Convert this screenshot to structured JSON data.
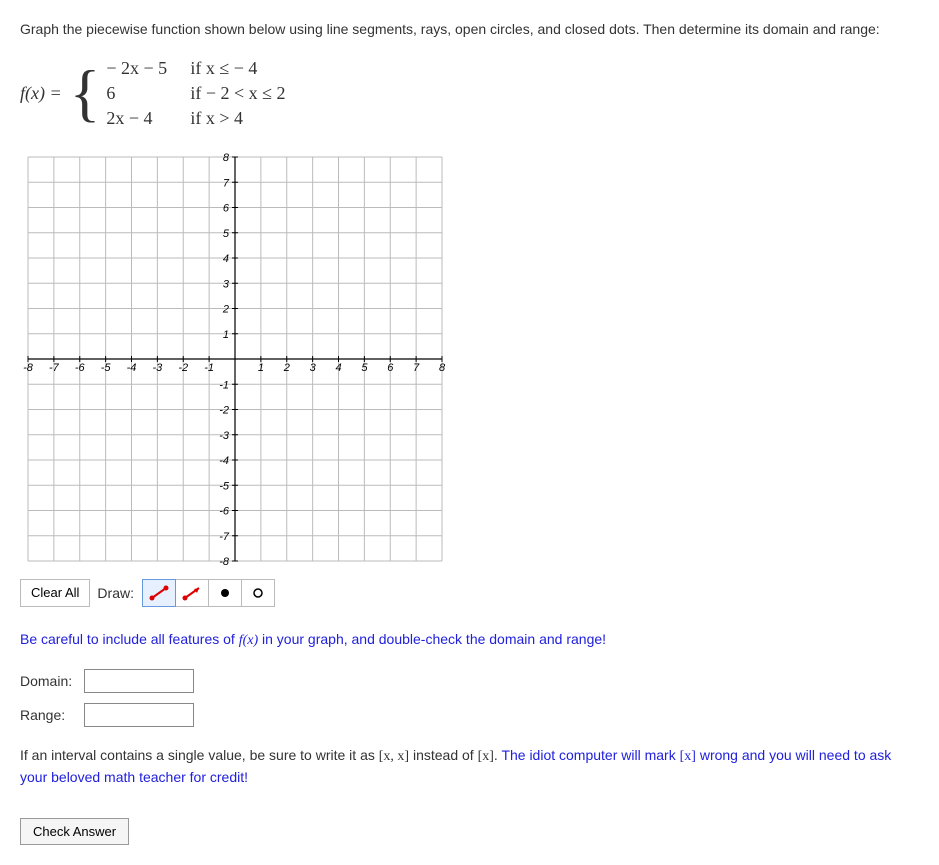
{
  "instructions": "Graph the piecewise function shown below using line segments, rays, open circles, and closed dots. Then determine its domain and range:",
  "function": {
    "lhs": "f(x) =",
    "pieces": [
      {
        "expr": "− 2x − 5",
        "cond": "if  x ≤ − 4"
      },
      {
        "expr": "6",
        "cond": "if  − 2 < x ≤ 2"
      },
      {
        "expr": "2x − 4",
        "cond": "if  x > 4"
      }
    ]
  },
  "chart_data": {
    "type": "grid",
    "xlim": [
      -8,
      8
    ],
    "ylim": [
      -8,
      8
    ],
    "xticks": [
      -8,
      -7,
      -6,
      -5,
      -4,
      -3,
      -2,
      -1,
      1,
      2,
      3,
      4,
      5,
      6,
      7,
      8
    ],
    "yticks": [
      -8,
      -7,
      -6,
      -5,
      -4,
      -3,
      -2,
      -1,
      1,
      2,
      3,
      4,
      5,
      6,
      7,
      8
    ]
  },
  "toolbar": {
    "clear_label": "Clear All",
    "draw_label": "Draw:"
  },
  "hint": {
    "prefix": "Be careful to include all features of ",
    "fx": "f(x)",
    "suffix": " in your graph, and double-check the domain and range!"
  },
  "fields": {
    "domain_label": "Domain:",
    "range_label": "Range:"
  },
  "note": {
    "p1a": "If an interval contains a single value, be sure to write it as ",
    "br1": "[x, x]",
    "p1b": " instead of ",
    "br2": "[x]",
    "p1c": ".  ",
    "idiot1": "The idiot computer will mark ",
    "br3": "[x]",
    "idiot2": " wrong and you will need to ask your beloved math teacher for credit!"
  },
  "check_label": "Check Answer"
}
